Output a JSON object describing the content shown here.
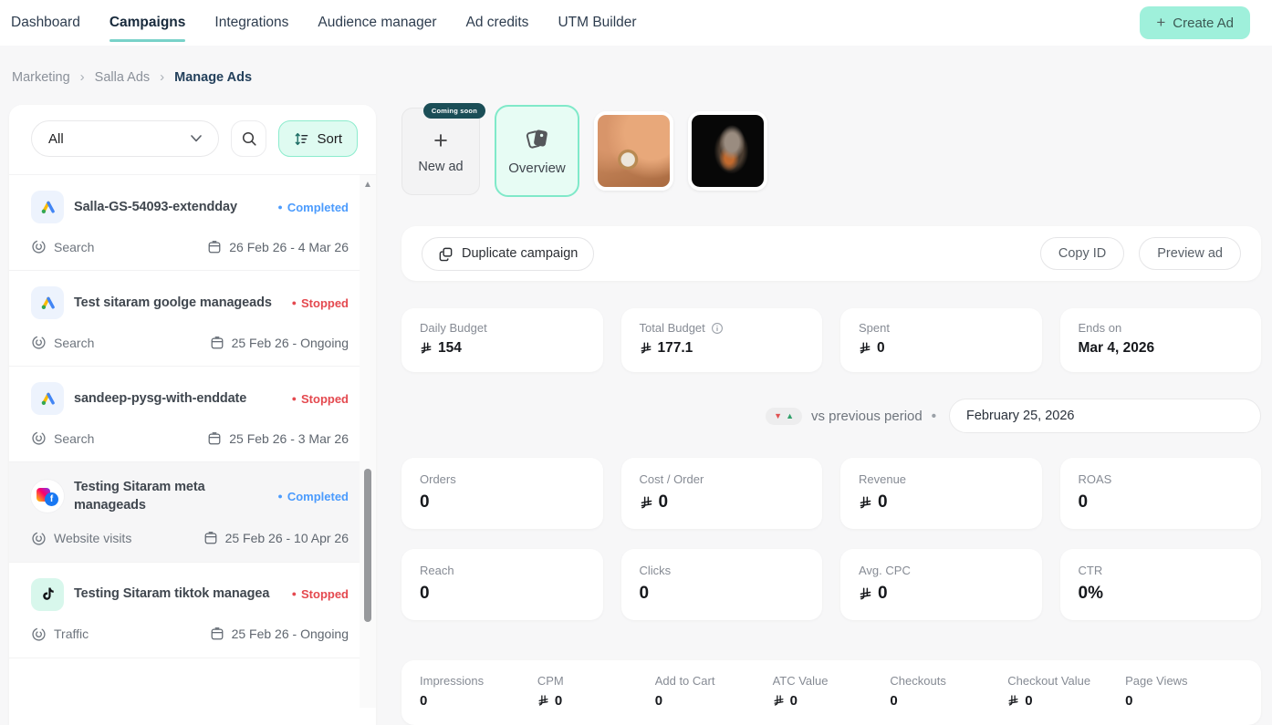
{
  "colors": {
    "accent_teal": "#79d2c9",
    "mint": "#9ff0db",
    "mint_light": "#e7fcf4",
    "mint_border": "#80e9c9",
    "completed_blue": "#4b9bfd",
    "stopped_red": "#e4494f",
    "navy": "#24415c",
    "badge_dark_teal": "#1b4e57"
  },
  "icons": {
    "plus": "+",
    "breadcrumb_separator": "›",
    "status_bullet": "●",
    "scroll_up_arrow": "▲",
    "trend_down": "▼",
    "trend_up": "▲",
    "separator_dot": "•",
    "facebook_f": "f"
  },
  "nav": {
    "items": [
      {
        "label": "Dashboard"
      },
      {
        "label": "Campaigns"
      },
      {
        "label": "Integrations"
      },
      {
        "label": "Audience manager"
      },
      {
        "label": "Ad credits"
      },
      {
        "label": "UTM Builder"
      }
    ],
    "create_ad_label": "Create Ad"
  },
  "breadcrumb": {
    "items": [
      "Marketing",
      "Salla Ads",
      "Manage Ads"
    ]
  },
  "sidebar": {
    "filter_value": "All",
    "sort_label": "Sort",
    "campaigns": [
      {
        "name": "Salla-GS-54093-extendday",
        "status": "Completed",
        "objective": "Search",
        "dates": "26 Feb 26 - 4 Mar 26"
      },
      {
        "name": "Test sitaram goolge manageads",
        "status": "Stopped",
        "objective": "Search",
        "dates": "25 Feb 26 - Ongoing"
      },
      {
        "name": "sandeep-pysg-with-enddate",
        "status": "Stopped",
        "objective": "Search",
        "dates": "25 Feb 26 - 3 Mar 26"
      },
      {
        "name": "Testing Sitaram meta manageads",
        "status": "Completed",
        "objective": "Website visits",
        "dates": "25 Feb 26 - 10 Apr 26"
      },
      {
        "name": "Testing Sitaram tiktok managea",
        "status": "Stopped",
        "objective": "Traffic",
        "dates": "25 Feb 26 - Ongoing"
      }
    ]
  },
  "tabs": {
    "new_ad": {
      "label": "New ad",
      "badge": "Coming soon"
    },
    "overview": {
      "label": "Overview"
    }
  },
  "actions": {
    "duplicate_label": "Duplicate campaign",
    "copy_id_label": "Copy ID",
    "preview_label": "Preview ad"
  },
  "budget_cards": [
    {
      "label": "Daily Budget",
      "value": "154"
    },
    {
      "label": "Total Budget",
      "value": "177.1"
    },
    {
      "label": "Spent",
      "value": "0"
    },
    {
      "label": "Ends on",
      "value": "Mar 4, 2026"
    }
  ],
  "comparison": {
    "label": "vs previous period",
    "separator": "•",
    "date_value": "February 25, 2026"
  },
  "stat_cards": [
    {
      "label": "Orders",
      "value": "0"
    },
    {
      "label": "Cost / Order",
      "value": "0"
    },
    {
      "label": "Revenue",
      "value": "0"
    },
    {
      "label": "ROAS",
      "value": "0"
    },
    {
      "label": "Reach",
      "value": "0"
    },
    {
      "label": "Clicks",
      "value": "0"
    },
    {
      "label": "Avg. CPC",
      "value": "0"
    },
    {
      "label": "CTR",
      "value": "0%"
    }
  ],
  "bottom_stats": [
    {
      "label": "Impressions",
      "value": "0"
    },
    {
      "label": "CPM",
      "value": "0"
    },
    {
      "label": "Add to Cart",
      "value": "0"
    },
    {
      "label": "ATC Value",
      "value": "0"
    },
    {
      "label": "Checkouts",
      "value": "0"
    },
    {
      "label": "Checkout Value",
      "value": "0"
    },
    {
      "label": "Page Views",
      "value": "0"
    }
  ]
}
